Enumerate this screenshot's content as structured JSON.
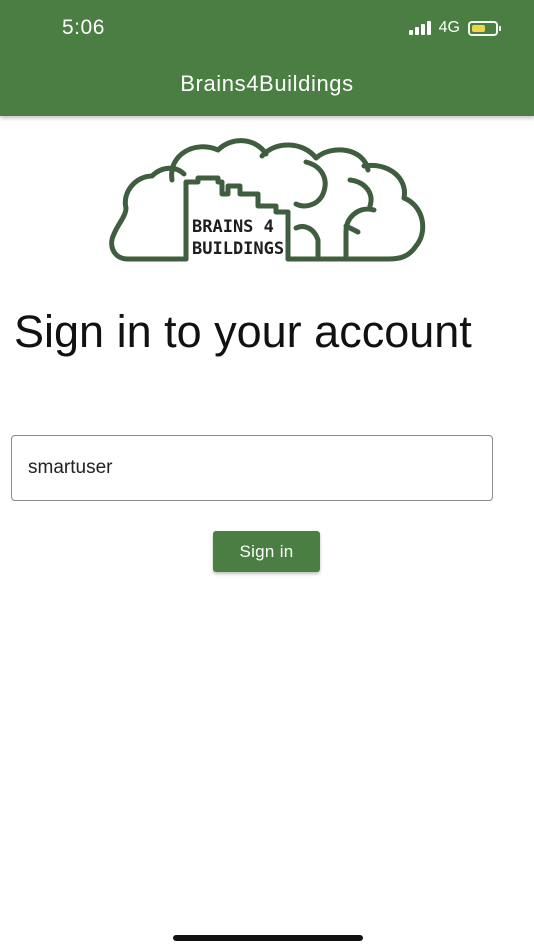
{
  "status_bar": {
    "time": "5:06",
    "network": "4G"
  },
  "app_bar": {
    "title": "Brains4Buildings"
  },
  "logo": {
    "line1": "BRAINS 4",
    "line2": "BUILDINGS",
    "color": "#3f5d3f"
  },
  "main": {
    "heading": "Sign in to your account",
    "username_value": "smartuser",
    "signin_label": "Sign in"
  },
  "colors": {
    "primary": "#4a7e42",
    "battery": "#f4dd4a"
  }
}
